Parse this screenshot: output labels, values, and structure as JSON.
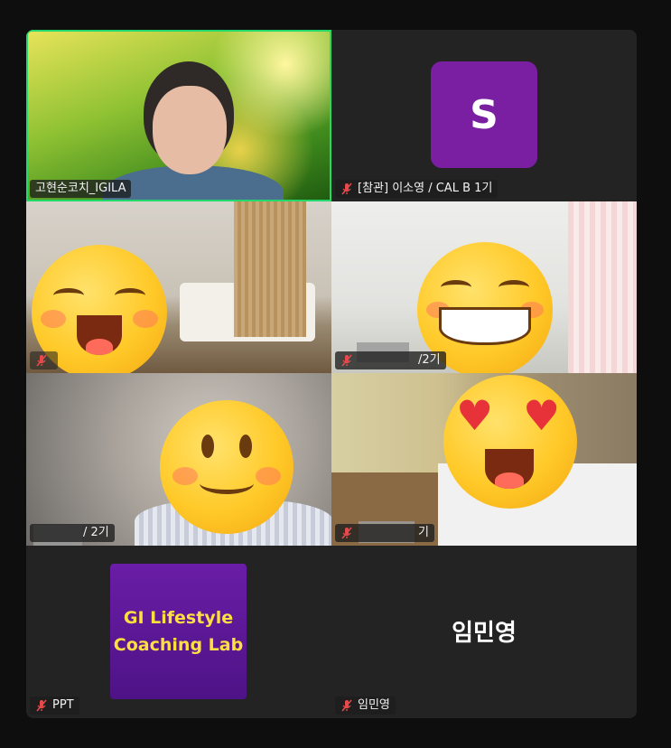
{
  "participants": [
    {
      "name": "고현순코치_IGILA",
      "muted": false,
      "active_speaker": true
    },
    {
      "name": "[참관] 이소영 / CAL B  1기",
      "muted": true,
      "avatar_letter": "S"
    },
    {
      "name": "",
      "muted": true
    },
    {
      "name": "/2기",
      "muted": true
    },
    {
      "name": "/ 2기",
      "muted": false
    },
    {
      "name": "기",
      "muted": true
    },
    {
      "name": "PPT",
      "muted": true,
      "card_line1": "GI Lifestyle",
      "card_line2": "Coaching Lab"
    },
    {
      "name": "임민영",
      "muted": true,
      "display_name": "임민영"
    }
  ],
  "colors": {
    "active_border": "#23d96b",
    "avatar_bg": "#7a1fa2",
    "ppt_bg": "#5a1896",
    "ppt_text": "#ffdf3f",
    "muted_icon": "#e8494a"
  },
  "icons": {
    "muted": "microphone-muted-icon"
  }
}
